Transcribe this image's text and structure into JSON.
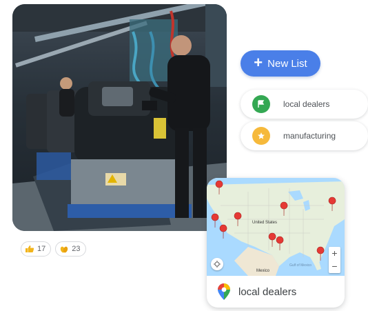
{
  "photo": {
    "alt": "factory-assembly-line-photo"
  },
  "reactions": [
    {
      "icon": "thumbs-up-icon",
      "count": "17"
    },
    {
      "icon": "clapping-hands-icon",
      "count": "23"
    }
  ],
  "new_list_button": {
    "label": "New List"
  },
  "lists": [
    {
      "label": "local dealers",
      "icon": "flag-icon",
      "color": "#34a853"
    },
    {
      "label": "manufacturing",
      "icon": "star-icon",
      "color": "#f6b93b"
    }
  ],
  "map_card": {
    "country_label": "United States",
    "city_labels": [
      "Mexico",
      "Gulf of Mexico"
    ],
    "zoom_in": "+",
    "zoom_out": "−",
    "footer_label": "local dealers",
    "pin_color": "#e53935"
  },
  "colors": {
    "accent": "#4a7fe8"
  }
}
